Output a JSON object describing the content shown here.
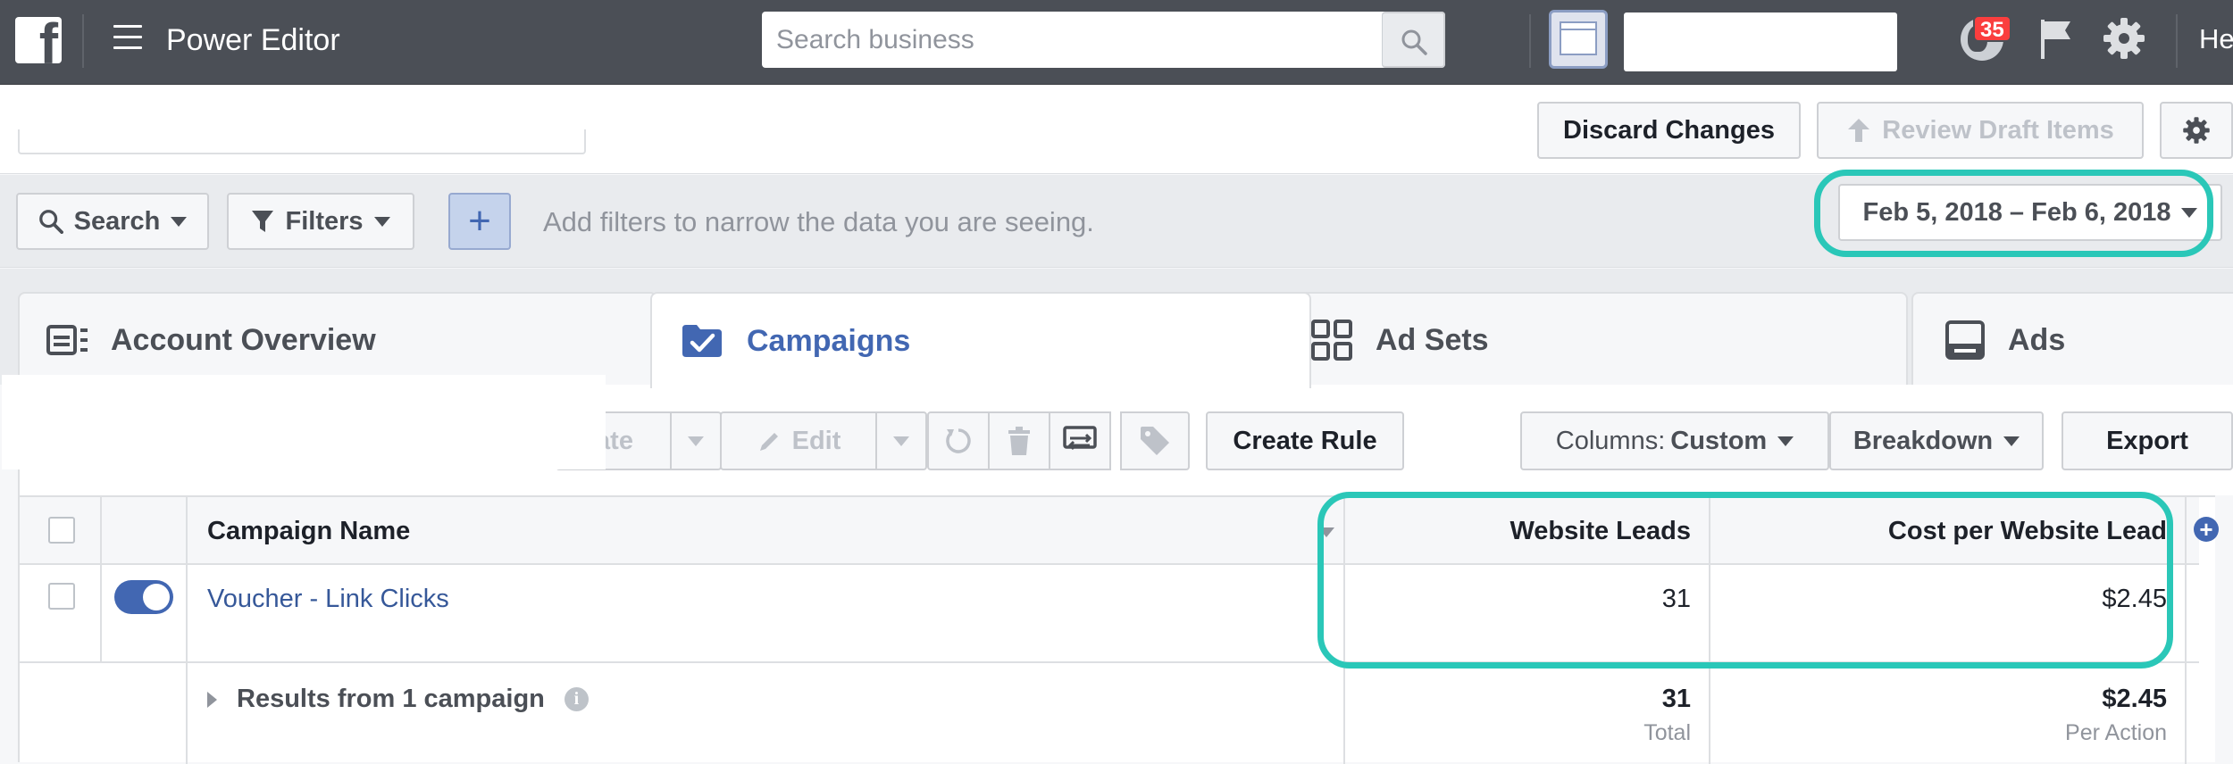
{
  "topbar": {
    "logo": "f",
    "title": "Power Editor",
    "search_placeholder": "Search business",
    "notification_count": "35",
    "user_name": "He"
  },
  "actions": {
    "discard_label": "Discard Changes",
    "review_label": "Review Draft Items"
  },
  "filters": {
    "search_label": "Search",
    "filters_label": "Filters",
    "add_symbol": "+",
    "hint": "Add filters to narrow the data you are seeing.",
    "date_range": "Feb 5, 2018 – Feb 6, 2018"
  },
  "tabs": [
    {
      "label": "Account Overview",
      "icon": "account-overview-icon"
    },
    {
      "label": "Campaigns",
      "icon": "folder-check-icon"
    },
    {
      "label": "Ad Sets",
      "icon": "grid-icon"
    },
    {
      "label": "Ads",
      "icon": "ad-icon"
    }
  ],
  "toolbar": {
    "create_label": "ate",
    "edit_label": "Edit",
    "create_rule_label": "Create Rule",
    "columns_label": "Columns:",
    "columns_value": "Custom",
    "breakdown_label": "Breakdown",
    "export_label": "Export"
  },
  "table": {
    "columns": [
      "Campaign Name",
      "Website Leads",
      "Cost per Website Lead"
    ],
    "rows": [
      {
        "name": "Voucher - Link Clicks",
        "leads": "31",
        "cost": "$2.45",
        "active": true
      }
    ],
    "summary": {
      "label": "Results from 1 campaign",
      "leads": "31",
      "leads_sub": "Total",
      "cost": "$2.45",
      "cost_sub": "Per Action"
    }
  },
  "colors": {
    "topbar": "#4b4f56",
    "accent": "#4267b2",
    "highlight": "#2ac7b8",
    "badge": "#fa3e3e"
  }
}
